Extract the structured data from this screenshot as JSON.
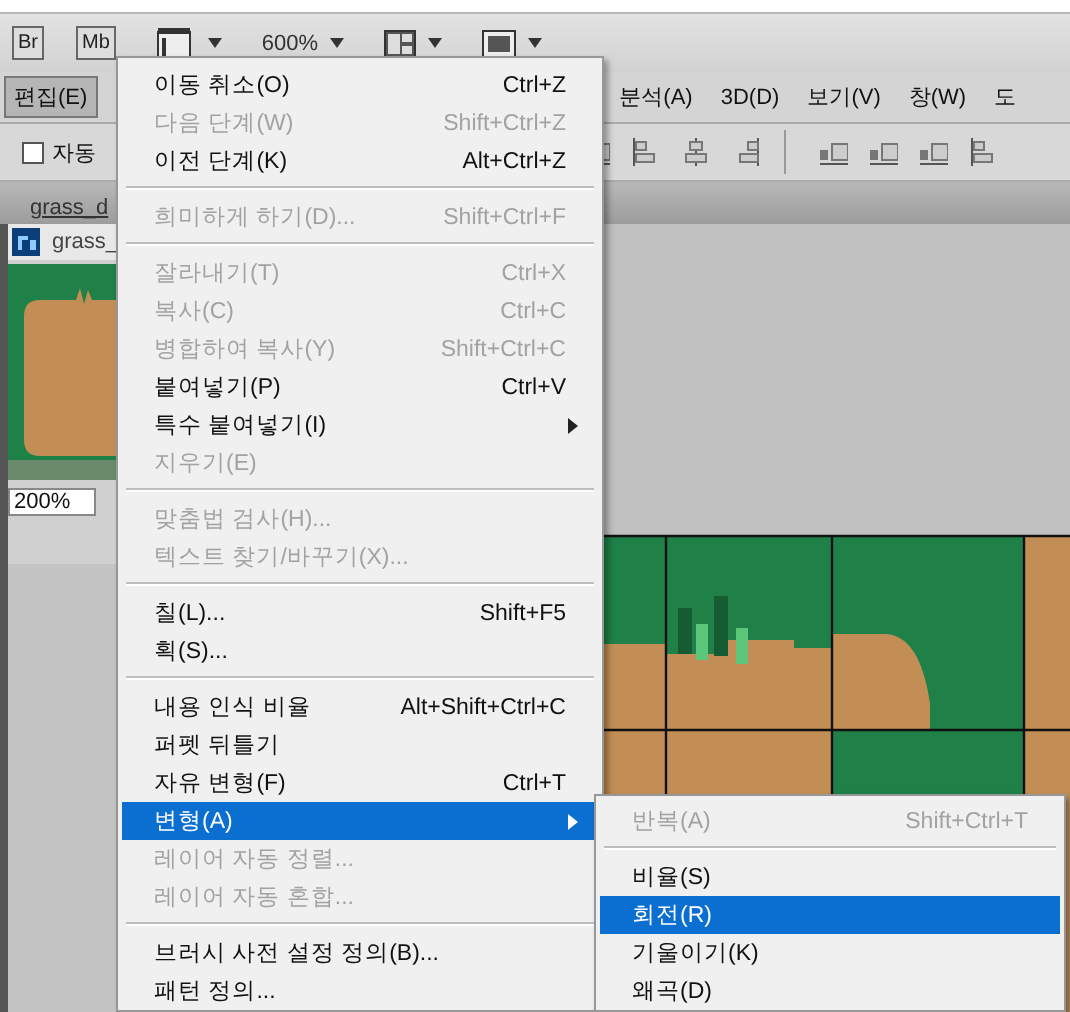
{
  "app_bar": {
    "buttons": [
      {
        "kind": "br",
        "label": "Br"
      },
      {
        "kind": "mb",
        "label": "Mb"
      }
    ],
    "zoom": "600%"
  },
  "menu_bar": {
    "items": [
      {
        "label": "편집(E)",
        "selected": true
      },
      {
        "label": "분석(A)",
        "selected": false
      },
      {
        "label": "3D(D)",
        "selected": false
      },
      {
        "label": "보기(V)",
        "selected": false
      },
      {
        "label": "창(W)",
        "selected": false
      },
      {
        "label": "도",
        "selected": false
      }
    ]
  },
  "options_bar": {
    "auto_select": {
      "label": "자동",
      "checked": false
    }
  },
  "document_tab": {
    "label": "grass_d"
  },
  "document_window": {
    "title": "grass_"
  },
  "navigator": {
    "zoom": "200%"
  },
  "edit_menu": {
    "groups": [
      [
        {
          "label": "이동 취소(O)",
          "shortcut": "Ctrl+Z",
          "disabled": false,
          "selected": false
        },
        {
          "label": "다음 단계(W)",
          "shortcut": "Shift+Ctrl+Z",
          "disabled": true,
          "selected": false
        },
        {
          "label": "이전 단계(K)",
          "shortcut": "Alt+Ctrl+Z",
          "disabled": false,
          "selected": false
        }
      ],
      [
        {
          "label": "희미하게 하기(D)...",
          "shortcut": "Shift+Ctrl+F",
          "disabled": true,
          "selected": false
        }
      ],
      [
        {
          "label": "잘라내기(T)",
          "shortcut": "Ctrl+X",
          "disabled": true,
          "selected": false
        },
        {
          "label": "복사(C)",
          "shortcut": "Ctrl+C",
          "disabled": true,
          "selected": false
        },
        {
          "label": "병합하여 복사(Y)",
          "shortcut": "Shift+Ctrl+C",
          "disabled": true,
          "selected": false
        },
        {
          "label": "붙여넣기(P)",
          "shortcut": "Ctrl+V",
          "disabled": false,
          "selected": false
        },
        {
          "label": "특수 붙여넣기(I)",
          "submenu": true,
          "disabled": false,
          "selected": false
        },
        {
          "label": "지우기(E)",
          "disabled": true,
          "selected": false
        }
      ],
      [
        {
          "label": "맞춤법 검사(H)...",
          "disabled": true,
          "selected": false
        },
        {
          "label": "텍스트 찾기/바꾸기(X)...",
          "disabled": true,
          "selected": false
        }
      ],
      [
        {
          "label": "칠(L)...",
          "shortcut": "Shift+F5",
          "disabled": false,
          "selected": false
        },
        {
          "label": "획(S)...",
          "disabled": false,
          "selected": false
        }
      ],
      [
        {
          "label": "내용 인식 비율",
          "shortcut": "Alt+Shift+Ctrl+C",
          "disabled": false,
          "selected": false
        },
        {
          "label": "퍼펫 뒤틀기",
          "disabled": false,
          "selected": false
        },
        {
          "label": "자유 변형(F)",
          "shortcut": "Ctrl+T",
          "disabled": false,
          "selected": false
        },
        {
          "label": "변형(A)",
          "submenu": true,
          "disabled": false,
          "selected": true
        },
        {
          "label": "레이어 자동 정렬...",
          "disabled": true,
          "selected": false
        },
        {
          "label": "레이어 자동 혼합...",
          "disabled": true,
          "selected": false
        }
      ],
      [
        {
          "label": "브러시 사전 설정 정의(B)...",
          "disabled": false,
          "selected": false
        },
        {
          "label": "패턴 정의...",
          "disabled": false,
          "selected": false
        }
      ]
    ]
  },
  "transform_submenu": {
    "groups": [
      [
        {
          "label": "반복(A)",
          "shortcut": "Shift+Ctrl+T",
          "disabled": true,
          "selected": false
        }
      ],
      [
        {
          "label": "비율(S)",
          "disabled": false,
          "selected": false
        },
        {
          "label": "회전(R)",
          "disabled": false,
          "selected": true
        },
        {
          "label": "기울이기(K)",
          "disabled": false,
          "selected": false
        },
        {
          "label": "왜곡(D)",
          "disabled": false,
          "selected": false
        }
      ]
    ]
  }
}
